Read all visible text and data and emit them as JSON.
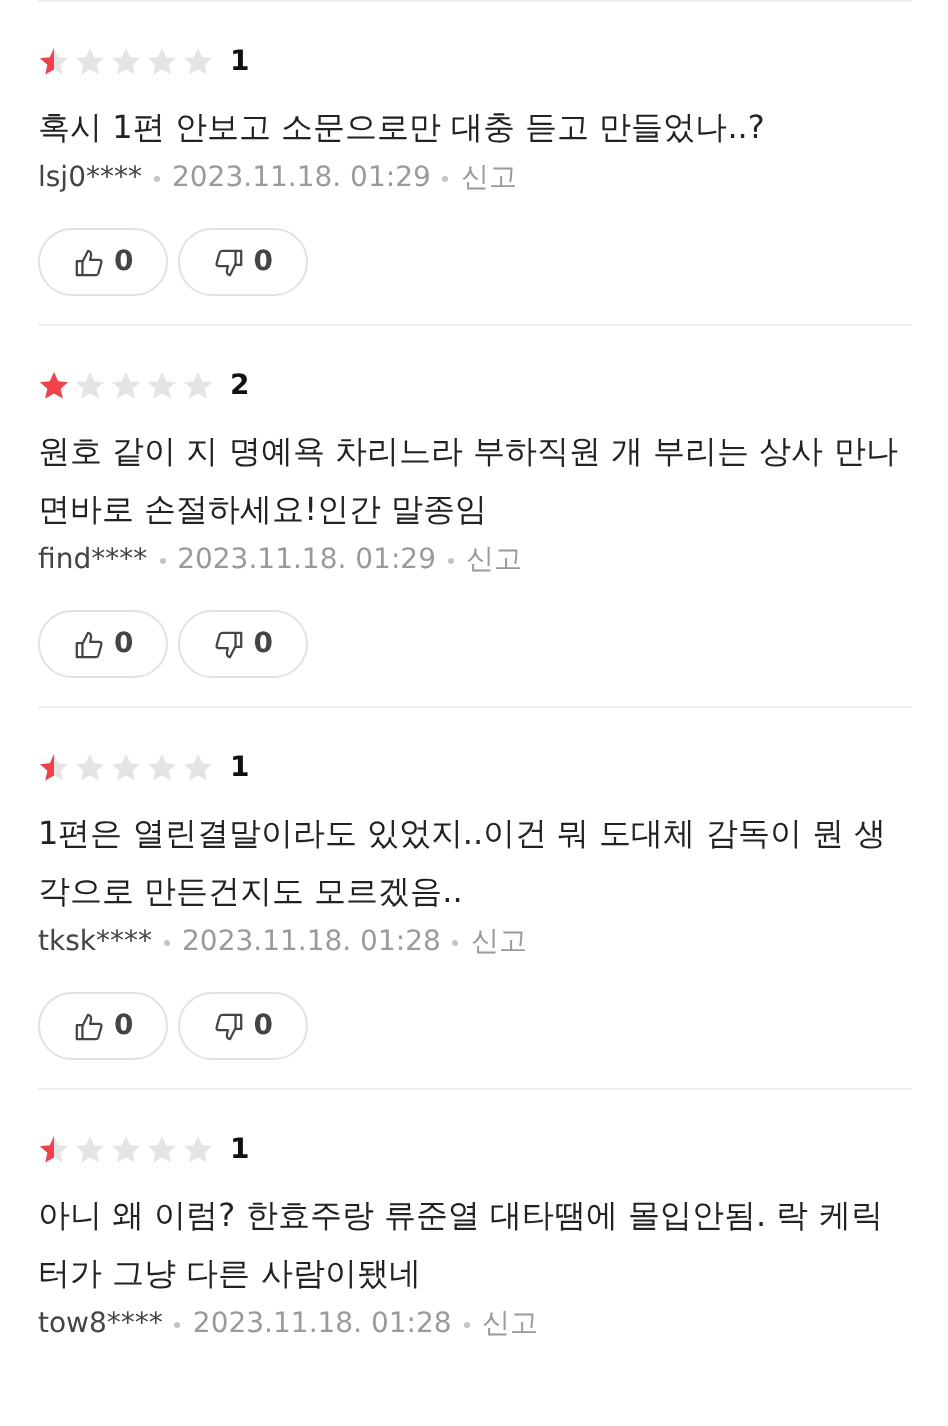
{
  "reviews": [
    {
      "stars": 0.5,
      "score": "1",
      "text": "혹시 1편 안보고 소문으로만 대충 듣고 만들었나..?",
      "user": "lsj0****",
      "date": "2023.11.18. 01:29",
      "report": "신고",
      "likes": "0",
      "dislikes": "0"
    },
    {
      "stars": 1,
      "score": "2",
      "text": "원호 같이 지 명예욕 차리느라 부하직원 개 부리는 상사 만나면바로 손절하세요!인간 말종임",
      "user": "find****",
      "date": "2023.11.18. 01:29",
      "report": "신고",
      "likes": "0",
      "dislikes": "0"
    },
    {
      "stars": 0.5,
      "score": "1",
      "text": "1편은 열린결말이라도 있었지..이건 뭐 도대체 감독이 뭔 생각으로 만든건지도 모르겠음..",
      "user": "tksk****",
      "date": "2023.11.18. 01:28",
      "report": "신고",
      "likes": "0",
      "dislikes": "0"
    },
    {
      "stars": 0.5,
      "score": "1",
      "text": "아니 왜 이럼? 한효주랑 류준열 대타땜에 몰입안됨. 락 케릭터가 그냥 다른 사람이됐네",
      "user": "tow8****",
      "date": "2023.11.18. 01:28",
      "report": "신고"
    }
  ]
}
